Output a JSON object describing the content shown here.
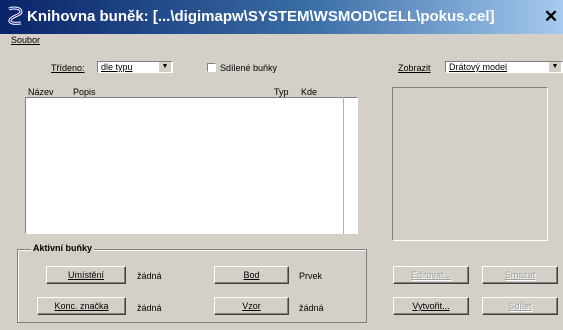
{
  "window": {
    "title": "Knihovna buněk: [...\\digimapw\\SYSTEM\\WSMOD\\CELL\\pokus.cel]",
    "close_label": "✕"
  },
  "menu": {
    "items": [
      {
        "label": "Soubor"
      }
    ]
  },
  "sort": {
    "label": "Třídeno:",
    "value": "dle typu"
  },
  "shared_cells": {
    "label": "Sdílené buňky",
    "checked": false
  },
  "view": {
    "label": "Zobrazit",
    "value": "Drátový model"
  },
  "list": {
    "columns": {
      "name": "Název",
      "description": "Popis",
      "type": "Typ",
      "where": "Kde"
    },
    "rows": []
  },
  "active_cells": {
    "title": "Aktivní buňky",
    "placement_button": "Umístění",
    "placement_value": "žádná",
    "point_button": "Bod",
    "point_value": "Prvek",
    "terminator_button": "Konc. značka",
    "terminator_value": "žádná",
    "pattern_button": "Vzor",
    "pattern_value": "žádná"
  },
  "actions": {
    "edit": "Editovat...",
    "delete": "Smazat",
    "create": "Vytvořit...",
    "share": "Sdílet"
  }
}
